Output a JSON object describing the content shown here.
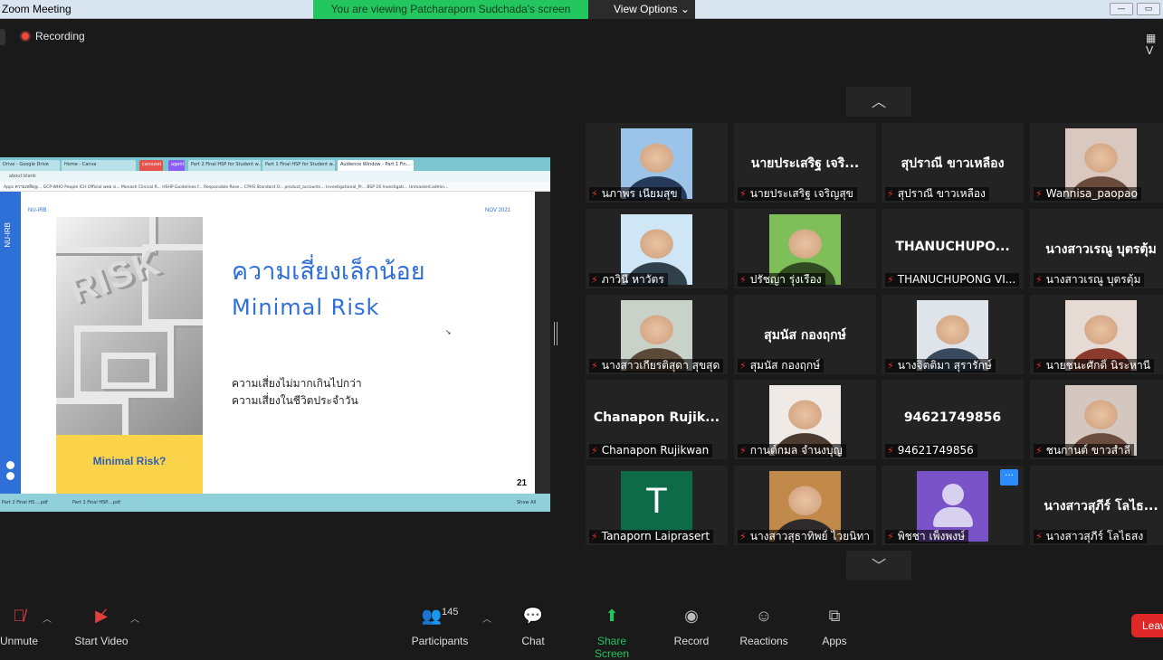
{
  "window": {
    "title": "Zoom Meeting"
  },
  "banner": {
    "text": "You are viewing Patcharaporn Sudchada's screen"
  },
  "view_options": {
    "label": "View Options ⌄"
  },
  "recording": {
    "label": "Recording"
  },
  "shared_screen": {
    "browser_tabs": [
      "Drive - Google Drive",
      "Home - Canva",
      "carousel",
      "agent",
      "Part 2 Final HSP for Student w...",
      "Part 1 Final HSP for Student w...",
      "Audience Window - Part 1 Fin..."
    ],
    "url": "about:blank",
    "bookmarks": "Apps   ความเหลือ@...   GCP-WHO People   ICH Official web si...   Monash Clinical R...   HSHP Guidelines f...   Responsible Rese...   CPHS Standard O...   product_accounts...   Investigational_Pr...   BSP 16 Investigati...   Unmasked.admin...",
    "slide": {
      "side_label": "NU-IRB",
      "header_left": "NU-IRB",
      "header_right": "NOV 2021",
      "image_word": "RISK",
      "yellow_label": "Minimal Risk?",
      "title_thai": "ความเสี่ยงเล็กน้อย",
      "title_en": "Minimal Risk",
      "body_line1": "ความเสี่ยงไม่มากเกินไปกว่า",
      "body_line2": "ความเสี่ยงในชีวิตประจำวัน",
      "page_number": "21"
    },
    "downloads": [
      "Part 2 Final HS....pdf",
      "Part 1 Final HSP....pdf",
      "Show All"
    ]
  },
  "gallery": {
    "nav_up": "︿",
    "nav_down": "﹀",
    "tiles": [
      {
        "caption": "นภาพร เนียมสุข",
        "video": "photo"
      },
      {
        "caption": "นายประเสริฐ เจริญสุข",
        "display": "นายประเสริฐ เจริ...",
        "video": "name"
      },
      {
        "caption": "สุปราณี ขาวเหลือง",
        "display": "สุปราณี ขาวเหลือง",
        "video": "name"
      },
      {
        "caption": "Wannisa_paopao",
        "video": "photo"
      },
      {
        "caption": "ภาวินี หาวัตร",
        "video": "photo"
      },
      {
        "caption": "ปรัชญา รุ่งเรือง",
        "video": "photo"
      },
      {
        "caption": "THANUCHUPONG VI...",
        "display": "THANUCHUPO...",
        "video": "name"
      },
      {
        "caption": "นางสาวเรณู บุตรตุ้ม",
        "display": "นางสาวเรณู บุตรตุ้ม",
        "video": "name"
      },
      {
        "caption": "นางสาวเกียรติสุดา สุขสุด",
        "video": "photo"
      },
      {
        "caption": "สุมนัส กองฤกษ์",
        "display": "สุมนัส กองฤกษ์",
        "video": "name"
      },
      {
        "caption": "นางจิตติมา สุรารักษ์",
        "video": "photo"
      },
      {
        "caption": "นายชนะศักดิ์ นิระหานี",
        "video": "photo"
      },
      {
        "caption": "Chanapon Rujikwan",
        "display": "Chanapon  Rujik...",
        "video": "name"
      },
      {
        "caption": "กานต์กมล  จำนงบุญ",
        "video": "photo"
      },
      {
        "caption": "94621749856",
        "display": "94621749856",
        "video": "name"
      },
      {
        "caption": "ชนกานต์ ขาวสำลี",
        "video": "photo"
      },
      {
        "caption": "Tanaporn Laiprasert",
        "video": "letter",
        "letter": "T"
      },
      {
        "caption": "นางสาวสุธาทิพย์ ไวยนิทา",
        "video": "photo"
      },
      {
        "caption": "พิชชา เพ็งพงษ์",
        "video": "avatar",
        "more": "···"
      },
      {
        "caption": "นางสาวสุภีร์ โลไธสง",
        "display": "นางสาวสุภีร์ โลไธ...",
        "video": "name"
      }
    ]
  },
  "toolbar": {
    "unmute": "Unmute",
    "start_video": "Start Video",
    "participants": "Participants",
    "participant_count": "145",
    "chat": "Chat",
    "share_screen": "Share Screen",
    "record": "Record",
    "reactions": "Reactions",
    "apps": "Apps",
    "leave": "Leave"
  },
  "colors": {
    "banner": "#22c55e",
    "share_screen_green": "#22c55e",
    "leave_red": "#e02828",
    "slide_blue": "#2f6fd8",
    "slide_yellow": "#fbd34b"
  }
}
